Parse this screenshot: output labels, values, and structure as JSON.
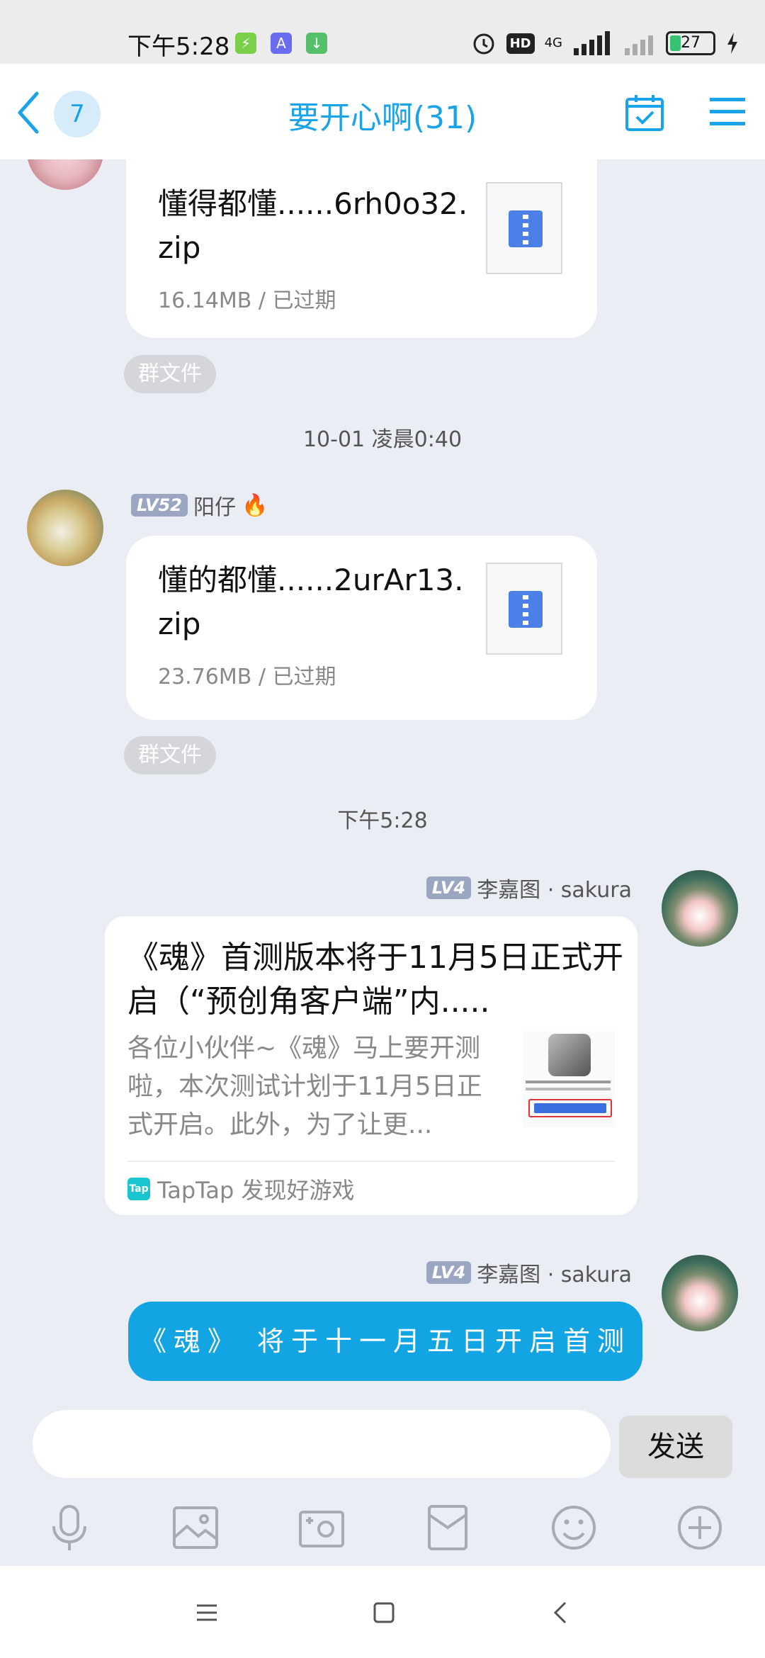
{
  "status_bar": {
    "time": "下午5:28",
    "network": "4G",
    "hd": "HD",
    "battery": "27",
    "battery_level": 0.27
  },
  "header": {
    "back_badge": "7",
    "title": "要开心啊(31)"
  },
  "messages": [
    {
      "type": "file",
      "filename": "懂得都懂......6rh0o32.zip",
      "meta": "16.14MB / 已过期",
      "tag": "群文件"
    },
    {
      "type": "timestamp",
      "text": "10-01 凌晨0:40"
    },
    {
      "type": "file",
      "sender_level": "LV52",
      "sender_name": "阳仔",
      "sender_emoji": "🔥",
      "filename": "懂的都懂......2urAr13.zip",
      "meta": "23.76MB / 已过期",
      "tag": "群文件"
    },
    {
      "type": "timestamp",
      "text": "下午5:28"
    },
    {
      "type": "share",
      "sender_level": "LV4",
      "sender_name": "李嘉图 · sakura",
      "title": "《魂》首测版本将于11月5日正式开启（“预创角客户端”内.....",
      "desc": "各位小伙伴~《魂》马上要开测啦，本次测试计划于11月5日正式开启。此外，为了让更...",
      "source_logo": "Tap",
      "source": "TapTap 发现好游戏"
    },
    {
      "type": "text",
      "sender_level": "LV4",
      "sender_name": "李嘉图 · sakura",
      "text": "《魂》 将于十一月五日开启首测"
    }
  ],
  "input": {
    "placeholder": "",
    "send_label": "发送"
  },
  "toolbar": [
    "microphone-icon",
    "image-icon",
    "camera-icon",
    "red-packet-icon",
    "emoji-icon",
    "plus-icon"
  ],
  "colors": {
    "accent": "#1aa3e8",
    "bubble_blue": "#12a4e3",
    "background": "#eaedf4"
  }
}
